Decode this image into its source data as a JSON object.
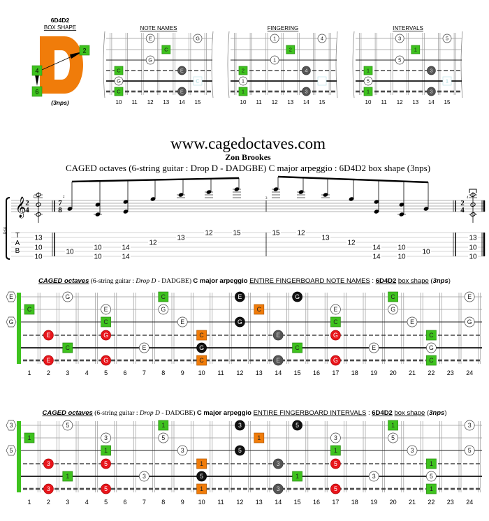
{
  "colors": {
    "root": "#3ec21e",
    "orange": "#f07c0a",
    "red": "#e8151b",
    "black": "#111111",
    "gray": "#555555",
    "nut": "#3ec21e",
    "faint": "#bfe3e8"
  },
  "top": {
    "box_id": "6D4D2",
    "box_label": "BOX SHAPE",
    "logo_letter": "D",
    "nps": "(3nps)",
    "logo_markers": [
      "2",
      "4",
      "6"
    ],
    "frets": [
      "10",
      "11",
      "12",
      "13",
      "14",
      "15"
    ],
    "diagrams": [
      {
        "title": "NOTE NAMES",
        "notes": [
          [
            1,
            12,
            "E",
            "white"
          ],
          [
            1,
            15,
            "G",
            "white"
          ],
          [
            2,
            13,
            "C",
            "root"
          ],
          [
            3,
            12,
            "G",
            "white"
          ],
          [
            4,
            10,
            "C",
            "root"
          ],
          [
            4,
            14,
            "E",
            "gray"
          ],
          [
            5,
            10,
            "G",
            "white"
          ],
          [
            5,
            15,
            "C",
            "faint"
          ],
          [
            6,
            10,
            "C",
            "root"
          ],
          [
            6,
            14,
            "E",
            "gray"
          ]
        ]
      },
      {
        "title": "FINGERING",
        "notes": [
          [
            1,
            12,
            "1",
            "white"
          ],
          [
            1,
            15,
            "4",
            "white"
          ],
          [
            2,
            13,
            "2",
            "root"
          ],
          [
            3,
            12,
            "1",
            "white"
          ],
          [
            4,
            10,
            "2",
            "root"
          ],
          [
            4,
            14,
            "4",
            "gray"
          ],
          [
            5,
            10,
            "1",
            "white"
          ],
          [
            5,
            15,
            "",
            "faint"
          ],
          [
            6,
            10,
            "1",
            "root"
          ],
          [
            6,
            14,
            "3",
            "gray"
          ]
        ]
      },
      {
        "title": "INTERVALS",
        "notes": [
          [
            1,
            12,
            "3",
            "white"
          ],
          [
            1,
            15,
            "5",
            "white"
          ],
          [
            2,
            13,
            "1",
            "root"
          ],
          [
            3,
            12,
            "5",
            "white"
          ],
          [
            4,
            10,
            "1",
            "root"
          ],
          [
            4,
            14,
            "3",
            "gray"
          ],
          [
            5,
            10,
            "5",
            "white"
          ],
          [
            5,
            15,
            "1",
            "faint"
          ],
          [
            6,
            10,
            "1",
            "root"
          ],
          [
            6,
            14,
            "3",
            "gray"
          ]
        ]
      }
    ]
  },
  "notation": {
    "site": "www.cagedoctaves.com",
    "author": "Zon Brookes",
    "subtitle": "CAGED octaves (6-string guitar : Drop D - DADGBE) C major arpeggio : 6D4D2 box shape (3nps)",
    "instrument": "E-Gt",
    "tab_letters": [
      "T",
      "A",
      "B"
    ],
    "time_signatures": [
      [
        "2",
        "4"
      ],
      [
        "7",
        "8"
      ],
      [
        "2",
        "4"
      ]
    ],
    "measure_numbers": [
      "1",
      "2",
      "3",
      "4"
    ],
    "events": [
      {
        "measure": 1,
        "pitches": [
          "C4",
          "C5",
          "C6"
        ],
        "duration": "half",
        "tab": [
          [
            2,
            "13"
          ],
          [
            4,
            "10"
          ],
          [
            6,
            "10"
          ]
        ]
      },
      {
        "measure": 2,
        "pitches": [
          "G4"
        ],
        "duration": "eighth",
        "tab": [
          [
            5,
            "10"
          ]
        ]
      },
      {
        "measure": 2,
        "pitches": [
          "C4",
          "C5"
        ],
        "duration": "eighth",
        "tab": [
          [
            4,
            "10"
          ],
          [
            6,
            "10"
          ]
        ]
      },
      {
        "measure": 2,
        "pitches": [
          "E4",
          "E5"
        ],
        "duration": "eighth",
        "tab": [
          [
            4,
            "14"
          ],
          [
            6,
            "14"
          ]
        ]
      },
      {
        "measure": 2,
        "pitches": [
          "G5"
        ],
        "duration": "eighth",
        "tab": [
          [
            3,
            "12"
          ]
        ]
      },
      {
        "measure": 2,
        "pitches": [
          "C6"
        ],
        "duration": "eighth",
        "tab": [
          [
            2,
            "13"
          ]
        ]
      },
      {
        "measure": 2,
        "pitches": [
          "E6"
        ],
        "duration": "eighth",
        "tab": [
          [
            1,
            "12"
          ]
        ]
      },
      {
        "measure": 2,
        "pitches": [
          "G6"
        ],
        "duration": "eighth",
        "tab": [
          [
            1,
            "15"
          ]
        ]
      },
      {
        "measure": 3,
        "pitches": [
          "G6"
        ],
        "duration": "eighth",
        "tab": [
          [
            1,
            "15"
          ]
        ]
      },
      {
        "measure": 3,
        "pitches": [
          "E6"
        ],
        "duration": "eighth",
        "tab": [
          [
            1,
            "12"
          ]
        ]
      },
      {
        "measure": 3,
        "pitches": [
          "C6"
        ],
        "duration": "eighth",
        "tab": [
          [
            2,
            "13"
          ]
        ]
      },
      {
        "measure": 3,
        "pitches": [
          "G5"
        ],
        "duration": "eighth",
        "tab": [
          [
            3,
            "12"
          ]
        ]
      },
      {
        "measure": 3,
        "pitches": [
          "E4",
          "E5"
        ],
        "duration": "eighth",
        "tab": [
          [
            4,
            "14"
          ],
          [
            6,
            "14"
          ]
        ]
      },
      {
        "measure": 3,
        "pitches": [
          "C4",
          "C5"
        ],
        "duration": "eighth",
        "tab": [
          [
            4,
            "10"
          ],
          [
            6,
            "10"
          ]
        ]
      },
      {
        "measure": 3,
        "pitches": [
          "G4"
        ],
        "duration": "eighth",
        "tab": [
          [
            5,
            "10"
          ]
        ]
      },
      {
        "measure": 4,
        "pitches": [
          "C4",
          "C5",
          "C6"
        ],
        "duration": "half",
        "tab": [
          [
            2,
            "13"
          ],
          [
            4,
            "10"
          ],
          [
            6,
            "10"
          ]
        ]
      }
    ]
  },
  "boards": [
    {
      "title": {
        "a": "CAGED octaves",
        "b": " (6-string guitar : ",
        "c": "Drop D",
        "d": " - DADGBE) ",
        "e": "C major arpeggio",
        "f": "ENTIRE FINGERBOARD NOTE NAMES",
        "g": " : ",
        "h": "6D4D2",
        "i": "box shape",
        "j": " (",
        "k": "3nps",
        "l": ")"
      },
      "notes": [
        [
          1,
          0,
          "E",
          "open"
        ],
        [
          1,
          3,
          "G",
          "white"
        ],
        [
          1,
          8,
          "C",
          "root"
        ],
        [
          1,
          12,
          "E",
          "black"
        ],
        [
          1,
          15,
          "G",
          "black"
        ],
        [
          1,
          20,
          "C",
          "root"
        ],
        [
          1,
          24,
          "E",
          "white"
        ],
        [
          2,
          1,
          "C",
          "root"
        ],
        [
          2,
          5,
          "E",
          "white"
        ],
        [
          2,
          8,
          "G",
          "white"
        ],
        [
          2,
          13,
          "C",
          "orange"
        ],
        [
          2,
          17,
          "E",
          "white"
        ],
        [
          2,
          20,
          "G",
          "white"
        ],
        [
          3,
          0,
          "G",
          "open"
        ],
        [
          3,
          5,
          "C",
          "root"
        ],
        [
          3,
          9,
          "E",
          "white"
        ],
        [
          3,
          12,
          "G",
          "black"
        ],
        [
          3,
          17,
          "C",
          "root"
        ],
        [
          3,
          21,
          "E",
          "white"
        ],
        [
          3,
          24,
          "G",
          "white"
        ],
        [
          4,
          2,
          "E",
          "red"
        ],
        [
          4,
          5,
          "G",
          "red"
        ],
        [
          4,
          10,
          "C",
          "orange"
        ],
        [
          4,
          14,
          "E",
          "gray"
        ],
        [
          4,
          17,
          "G",
          "red"
        ],
        [
          4,
          22,
          "C",
          "root"
        ],
        [
          5,
          3,
          "C",
          "root"
        ],
        [
          5,
          7,
          "E",
          "white"
        ],
        [
          5,
          10,
          "G",
          "black"
        ],
        [
          5,
          15,
          "C",
          "root"
        ],
        [
          5,
          19,
          "E",
          "white"
        ],
        [
          5,
          22,
          "G",
          "white"
        ],
        [
          6,
          2,
          "E",
          "red"
        ],
        [
          6,
          5,
          "G",
          "red"
        ],
        [
          6,
          10,
          "C",
          "orange"
        ],
        [
          6,
          14,
          "E",
          "gray"
        ],
        [
          6,
          17,
          "G",
          "red"
        ],
        [
          6,
          22,
          "C",
          "root"
        ]
      ]
    },
    {
      "title": {
        "a": "CAGED octaves",
        "b": " (6-string guitar : ",
        "c": "Drop D",
        "d": " - DADGBE) ",
        "e": "C major arpeggio",
        "f": "ENTIRE FINGERBOARD INTERVALS",
        "g": " : ",
        "h": "6D4D2",
        "i": "box shape",
        "j": " (",
        "k": "3nps",
        "l": ")"
      },
      "notes": [
        [
          1,
          0,
          "3",
          "open"
        ],
        [
          1,
          3,
          "5",
          "white"
        ],
        [
          1,
          8,
          "1",
          "root"
        ],
        [
          1,
          12,
          "3",
          "black"
        ],
        [
          1,
          15,
          "5",
          "black"
        ],
        [
          1,
          20,
          "1",
          "root"
        ],
        [
          1,
          24,
          "3",
          "white"
        ],
        [
          2,
          1,
          "1",
          "root"
        ],
        [
          2,
          5,
          "3",
          "white"
        ],
        [
          2,
          8,
          "5",
          "white"
        ],
        [
          2,
          13,
          "1",
          "orange"
        ],
        [
          2,
          17,
          "3",
          "white"
        ],
        [
          2,
          20,
          "5",
          "white"
        ],
        [
          3,
          0,
          "5",
          "open"
        ],
        [
          3,
          5,
          "1",
          "root"
        ],
        [
          3,
          9,
          "3",
          "white"
        ],
        [
          3,
          12,
          "5",
          "black"
        ],
        [
          3,
          17,
          "1",
          "root"
        ],
        [
          3,
          21,
          "3",
          "white"
        ],
        [
          3,
          24,
          "5",
          "white"
        ],
        [
          4,
          2,
          "3",
          "red"
        ],
        [
          4,
          5,
          "5",
          "red"
        ],
        [
          4,
          10,
          "1",
          "orange"
        ],
        [
          4,
          14,
          "3",
          "gray"
        ],
        [
          4,
          17,
          "5",
          "red"
        ],
        [
          4,
          22,
          "1",
          "root"
        ],
        [
          5,
          3,
          "1",
          "root"
        ],
        [
          5,
          7,
          "3",
          "white"
        ],
        [
          5,
          10,
          "5",
          "black"
        ],
        [
          5,
          15,
          "1",
          "root"
        ],
        [
          5,
          19,
          "3",
          "white"
        ],
        [
          5,
          22,
          "5",
          "white"
        ],
        [
          6,
          2,
          "3",
          "red"
        ],
        [
          6,
          5,
          "5",
          "red"
        ],
        [
          6,
          10,
          "1",
          "orange"
        ],
        [
          6,
          14,
          "3",
          "gray"
        ],
        [
          6,
          17,
          "5",
          "red"
        ],
        [
          6,
          22,
          "1",
          "root"
        ]
      ]
    }
  ],
  "fret_numbers": [
    "1",
    "2",
    "3",
    "4",
    "5",
    "6",
    "7",
    "8",
    "9",
    "10",
    "11",
    "12",
    "13",
    "14",
    "15",
    "16",
    "17",
    "18",
    "19",
    "20",
    "21",
    "22",
    "23",
    "24"
  ]
}
